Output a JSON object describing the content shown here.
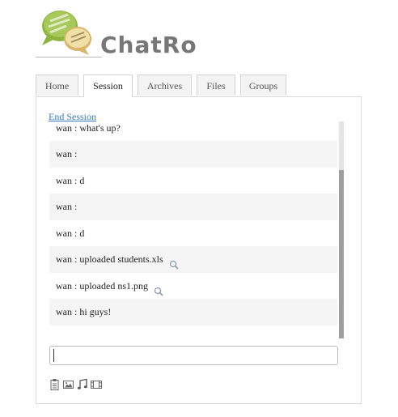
{
  "app": {
    "title": "ChatRo"
  },
  "tabs": [
    {
      "label": "Home"
    },
    {
      "label": "Session"
    },
    {
      "label": "Archives"
    },
    {
      "label": "Files"
    },
    {
      "label": "Groups"
    }
  ],
  "active_tab": "Session",
  "session": {
    "end_label": "End Session"
  },
  "messages": [
    {
      "text": "wan : what's up?"
    },
    {
      "text": "wan :"
    },
    {
      "text": "wan : d"
    },
    {
      "text": "wan :"
    },
    {
      "text": "wan : d"
    },
    {
      "text": "wan : uploaded students.xls",
      "icon": "magnifier-icon"
    },
    {
      "text": "wan : uploaded ns1.png",
      "icon": "magnifier-icon"
    },
    {
      "text": "wan : hi guys!"
    }
  ],
  "input": {
    "value": "",
    "placeholder": ""
  },
  "toolbar": {
    "icons": [
      "clipboard-icon",
      "image-icon",
      "music-icon",
      "video-icon"
    ]
  },
  "colors": {
    "link": "#3a7bbf",
    "logo_text": "#777777",
    "bubble_green": "#8db43c",
    "bubble_yellow": "#e8c777"
  }
}
